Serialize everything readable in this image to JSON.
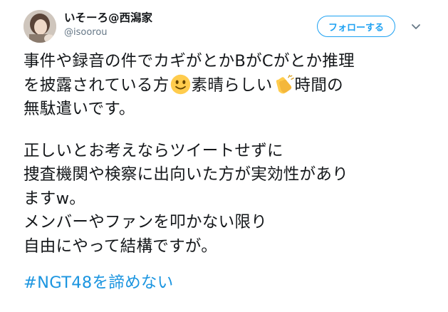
{
  "user": {
    "display_name": "いそーろ@西潟家",
    "handle": "@isoorou"
  },
  "follow_button": {
    "label": "フォローする"
  },
  "tweet": {
    "line1": "事件や録音の件でカギがとかBがCがとか推理",
    "line2_a": "を披露されている方",
    "line2_b": "素晴らしい",
    "line2_c": "時間の",
    "line3": "無駄遣いです。",
    "line4": "正しいとお考えならツイートせずに",
    "line5": "捜査機関や検察に出向いた方が実効性があり",
    "line6": "ますw。",
    "line7": "メンバーやファンを叩かない限り",
    "line8": "自由にやって結構ですが。",
    "hashtag": "#NGT48を諦めない"
  },
  "icons": {
    "slightly_smiling": "slightly-smiling-face-emoji",
    "clapping": "clapping-hands-emoji",
    "caret": "chevron-down-icon"
  },
  "colors": {
    "accent": "#1da1f2",
    "hashtag": "#1b95e0",
    "text": "#14171a",
    "muted": "#657786"
  }
}
